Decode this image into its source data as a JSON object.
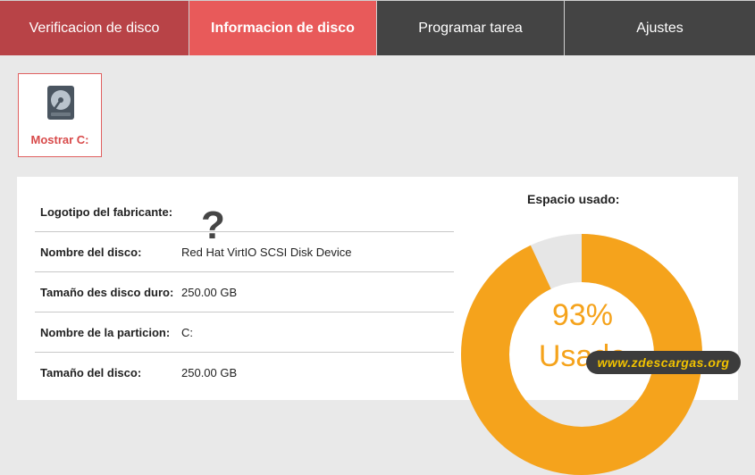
{
  "tabs": [
    {
      "label": "Verificacion de disco",
      "active": false
    },
    {
      "label": "Informacion de disco",
      "active": true
    },
    {
      "label": "Programar tarea",
      "active": false
    },
    {
      "label": "Ajustes",
      "active": false
    }
  ],
  "drive": {
    "label": "Mostrar C:",
    "icon": "hard-disk-icon"
  },
  "info": {
    "manufacturer_logo_label": "Logotipo del fabricante:",
    "manufacturer_logo_icon": "question-mark-icon",
    "disk_name_label": "Nombre del disco:",
    "disk_name_value": "Red Hat VirtIO SCSI Disk Device",
    "hdd_size_label": "Tamaño des disco duro:",
    "hdd_size_value": "250.00 GB",
    "partition_name_label": "Nombre de la particion:",
    "partition_name_value": "C:",
    "disk_size_label": "Tamaño del disco:",
    "disk_size_value": "250.00 GB"
  },
  "usage": {
    "title": "Espacio usado:",
    "percent": 93,
    "percent_text": "93%",
    "used_label": "Usado",
    "color": "#f5a31c"
  },
  "watermark": {
    "text": "www.zdescargas.org"
  },
  "colors": {
    "tab_inactive_red": "#b84347",
    "tab_active": "#e85a5a",
    "tab_dark": "#444444",
    "accent": "#d84a4a",
    "donut": "#f5a31c"
  }
}
